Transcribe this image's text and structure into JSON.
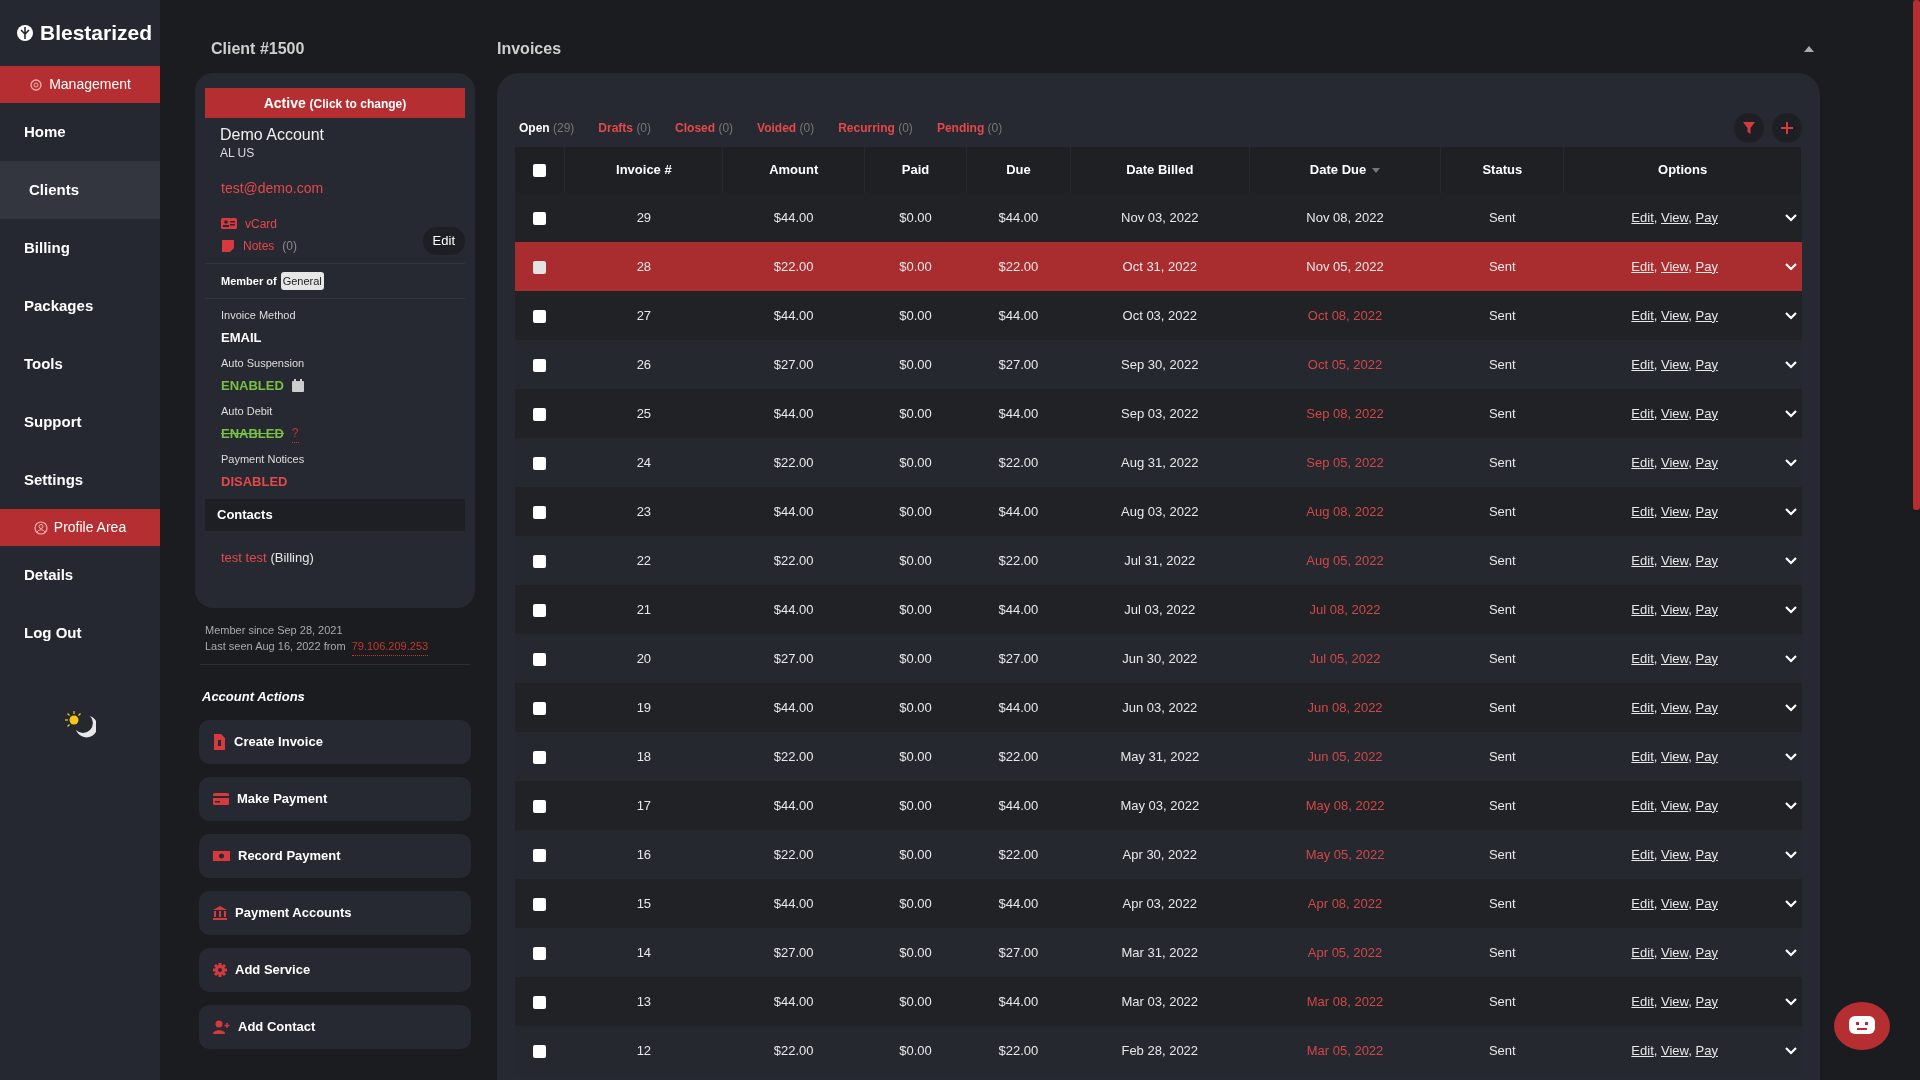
{
  "brand": {
    "name": "Blestarized"
  },
  "sidebar": {
    "items": [
      {
        "kind": "section",
        "label": "Management"
      },
      {
        "kind": "link",
        "label": "Home",
        "selected": false
      },
      {
        "kind": "link",
        "label": "Clients",
        "selected": true
      },
      {
        "kind": "link",
        "label": "Billing",
        "selected": false
      },
      {
        "kind": "link",
        "label": "Packages",
        "selected": false
      },
      {
        "kind": "link",
        "label": "Tools",
        "selected": false
      },
      {
        "kind": "link",
        "label": "Support",
        "selected": false
      },
      {
        "kind": "link",
        "label": "Settings",
        "selected": false
      },
      {
        "kind": "section",
        "label": "Profile Area"
      },
      {
        "kind": "link",
        "label": "Details",
        "selected": false
      },
      {
        "kind": "link",
        "label": "Log Out",
        "selected": false
      }
    ]
  },
  "client": {
    "title": "Client #1500",
    "status": "Active",
    "status_hint": "(Click to change)",
    "name": "Demo Account",
    "location": "AL US",
    "email": "test@demo.com",
    "vcard": "vCard",
    "notes": "Notes",
    "notes_count": "(0)",
    "edit": "Edit",
    "member_label": "Member of",
    "group": "General",
    "settings": [
      {
        "label": "Invoice Method",
        "value": "EMAIL",
        "kind": "text",
        "struck": false
      },
      {
        "label": "Auto Suspension",
        "value": "ENABLED",
        "kind": "enabled",
        "struck": false,
        "calendar": true
      },
      {
        "label": "Auto Debit",
        "value": "ENABLED",
        "kind": "enabled",
        "struck": true,
        "help": "?"
      },
      {
        "label": "Payment Notices",
        "value": "DISABLED",
        "kind": "disabled",
        "struck": false
      }
    ],
    "contacts_title": "Contacts",
    "contacts": [
      {
        "name": "test test",
        "role": "(Billing)"
      }
    ],
    "member_since": "Member since Sep 28, 2021",
    "last_seen": "Last seen Aug 16, 2022 from",
    "ip": "79.106.209.253"
  },
  "actions": {
    "title": "Account Actions",
    "buttons": [
      {
        "label": "Create Invoice"
      },
      {
        "label": "Make Payment"
      },
      {
        "label": "Record Payment"
      },
      {
        "label": "Payment Accounts"
      },
      {
        "label": "Add Service"
      },
      {
        "label": "Add Contact"
      }
    ]
  },
  "invoices": {
    "title": "Invoices",
    "tabs": [
      {
        "label": "Open",
        "count": "(29)",
        "selected": true
      },
      {
        "label": "Drafts",
        "count": "(0)",
        "selected": false
      },
      {
        "label": "Closed",
        "count": "(0)",
        "selected": false
      },
      {
        "label": "Voided",
        "count": "(0)",
        "selected": false
      },
      {
        "label": "Recurring",
        "count": "(0)",
        "selected": false
      },
      {
        "label": "Pending",
        "count": "(0)",
        "selected": false
      }
    ],
    "select_all": false,
    "columns": [
      {
        "label": "Invoice #",
        "sorted": false
      },
      {
        "label": "Amount",
        "sorted": false
      },
      {
        "label": "Paid",
        "sorted": false
      },
      {
        "label": "Due",
        "sorted": false
      },
      {
        "label": "Date Billed",
        "sorted": false
      },
      {
        "label": "Date Due",
        "sorted": true
      },
      {
        "label": "Status",
        "sorted": false
      },
      {
        "label": "Options",
        "sorted": false
      }
    ],
    "rows": [
      {
        "invoice": "29",
        "amount": "$44.00",
        "paid": "$0.00",
        "due": "$44.00",
        "billed": "Nov 03, 2022",
        "date_due": "Nov 08, 2022",
        "overdue": false,
        "status": "Sent",
        "links": [
          "Edit",
          "View",
          "Pay"
        ],
        "separator": ",",
        "selected": false,
        "checked": false
      },
      {
        "invoice": "28",
        "amount": "$22.00",
        "paid": "$0.00",
        "due": "$22.00",
        "billed": "Oct 31, 2022",
        "date_due": "Nov 05, 2022",
        "overdue": false,
        "status": "Sent",
        "links": [
          "Edit",
          "View",
          "Pay"
        ],
        "separator": ",",
        "selected": true,
        "checked": false
      },
      {
        "invoice": "27",
        "amount": "$44.00",
        "paid": "$0.00",
        "due": "$44.00",
        "billed": "Oct 03, 2022",
        "date_due": "Oct 08, 2022",
        "overdue": true,
        "status": "Sent",
        "links": [
          "Edit",
          "View",
          "Pay"
        ],
        "separator": ",",
        "selected": false,
        "checked": false
      },
      {
        "invoice": "26",
        "amount": "$27.00",
        "paid": "$0.00",
        "due": "$27.00",
        "billed": "Sep 30, 2022",
        "date_due": "Oct 05, 2022",
        "overdue": true,
        "status": "Sent",
        "links": [
          "Edit",
          "View",
          "Pay"
        ],
        "separator": ",",
        "selected": false,
        "checked": false
      },
      {
        "invoice": "25",
        "amount": "$44.00",
        "paid": "$0.00",
        "due": "$44.00",
        "billed": "Sep 03, 2022",
        "date_due": "Sep 08, 2022",
        "overdue": true,
        "status": "Sent",
        "links": [
          "Edit",
          "View",
          "Pay"
        ],
        "separator": ",",
        "selected": false,
        "checked": false
      },
      {
        "invoice": "24",
        "amount": "$22.00",
        "paid": "$0.00",
        "due": "$22.00",
        "billed": "Aug 31, 2022",
        "date_due": "Sep 05, 2022",
        "overdue": true,
        "status": "Sent",
        "links": [
          "Edit",
          "View",
          "Pay"
        ],
        "separator": ",",
        "selected": false,
        "checked": false
      },
      {
        "invoice": "23",
        "amount": "$44.00",
        "paid": "$0.00",
        "due": "$44.00",
        "billed": "Aug 03, 2022",
        "date_due": "Aug 08, 2022",
        "overdue": true,
        "status": "Sent",
        "links": [
          "Edit",
          "View",
          "Pay"
        ],
        "separator": ",",
        "selected": false,
        "checked": false
      },
      {
        "invoice": "22",
        "amount": "$22.00",
        "paid": "$0.00",
        "due": "$22.00",
        "billed": "Jul 31, 2022",
        "date_due": "Aug 05, 2022",
        "overdue": true,
        "status": "Sent",
        "links": [
          "Edit",
          "View",
          "Pay"
        ],
        "separator": ",",
        "selected": false,
        "checked": false
      },
      {
        "invoice": "21",
        "amount": "$44.00",
        "paid": "$0.00",
        "due": "$44.00",
        "billed": "Jul 03, 2022",
        "date_due": "Jul 08, 2022",
        "overdue": true,
        "status": "Sent",
        "links": [
          "Edit",
          "View",
          "Pay"
        ],
        "separator": ",",
        "selected": false,
        "checked": false
      },
      {
        "invoice": "20",
        "amount": "$27.00",
        "paid": "$0.00",
        "due": "$27.00",
        "billed": "Jun 30, 2022",
        "date_due": "Jul 05, 2022",
        "overdue": true,
        "status": "Sent",
        "links": [
          "Edit",
          "View",
          "Pay"
        ],
        "separator": ",",
        "selected": false,
        "checked": false
      },
      {
        "invoice": "19",
        "amount": "$44.00",
        "paid": "$0.00",
        "due": "$44.00",
        "billed": "Jun 03, 2022",
        "date_due": "Jun 08, 2022",
        "overdue": true,
        "status": "Sent",
        "links": [
          "Edit",
          "View",
          "Pay"
        ],
        "separator": ",",
        "selected": false,
        "checked": false
      },
      {
        "invoice": "18",
        "amount": "$22.00",
        "paid": "$0.00",
        "due": "$22.00",
        "billed": "May 31, 2022",
        "date_due": "Jun 05, 2022",
        "overdue": true,
        "status": "Sent",
        "links": [
          "Edit",
          "View",
          "Pay"
        ],
        "separator": ",",
        "selected": false,
        "checked": false
      },
      {
        "invoice": "17",
        "amount": "$44.00",
        "paid": "$0.00",
        "due": "$44.00",
        "billed": "May 03, 2022",
        "date_due": "May 08, 2022",
        "overdue": true,
        "status": "Sent",
        "links": [
          "Edit",
          "View",
          "Pay"
        ],
        "separator": ",",
        "selected": false,
        "checked": false
      },
      {
        "invoice": "16",
        "amount": "$22.00",
        "paid": "$0.00",
        "due": "$22.00",
        "billed": "Apr 30, 2022",
        "date_due": "May 05, 2022",
        "overdue": true,
        "status": "Sent",
        "links": [
          "Edit",
          "View",
          "Pay"
        ],
        "separator": ",",
        "selected": false,
        "checked": false
      },
      {
        "invoice": "15",
        "amount": "$44.00",
        "paid": "$0.00",
        "due": "$44.00",
        "billed": "Apr 03, 2022",
        "date_due": "Apr 08, 2022",
        "overdue": true,
        "status": "Sent",
        "links": [
          "Edit",
          "View",
          "Pay"
        ],
        "separator": ",",
        "selected": false,
        "checked": false
      },
      {
        "invoice": "14",
        "amount": "$27.00",
        "paid": "$0.00",
        "due": "$27.00",
        "billed": "Mar 31, 2022",
        "date_due": "Apr 05, 2022",
        "overdue": true,
        "status": "Sent",
        "links": [
          "Edit",
          "View",
          "Pay"
        ],
        "separator": ",",
        "selected": false,
        "checked": false
      },
      {
        "invoice": "13",
        "amount": "$44.00",
        "paid": "$0.00",
        "due": "$44.00",
        "billed": "Mar 03, 2022",
        "date_due": "Mar 08, 2022",
        "overdue": true,
        "status": "Sent",
        "links": [
          "Edit",
          "View",
          "Pay"
        ],
        "separator": ",",
        "selected": false,
        "checked": false
      },
      {
        "invoice": "12",
        "amount": "$22.00",
        "paid": "$0.00",
        "due": "$22.00",
        "billed": "Feb 28, 2022",
        "date_due": "Mar 05, 2022",
        "overdue": true,
        "status": "Sent",
        "links": [
          "Edit",
          "View",
          "Pay"
        ],
        "separator": ",",
        "selected": false,
        "checked": false
      }
    ]
  }
}
